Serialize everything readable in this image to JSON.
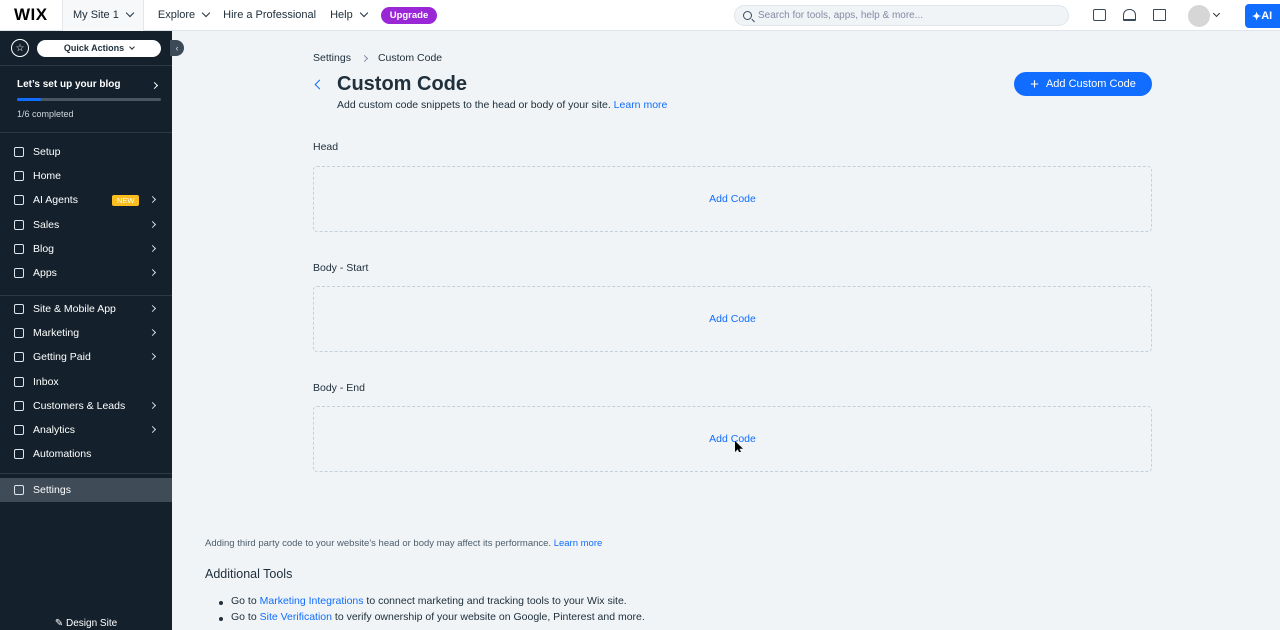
{
  "topbar": {
    "logo": "WIX",
    "site_name": "My Site 1",
    "nav": [
      "Explore",
      "Hire a Professional",
      "Help"
    ],
    "upgrade_label": "Upgrade",
    "search_placeholder": "Search for tools, apps, help & more...",
    "ai_label": "AI"
  },
  "sidebar": {
    "quick_actions": "Quick Actions",
    "setup_title": "Let’s set up your blog",
    "progress_fraction": 0.167,
    "completed_text": "1/6 completed",
    "items_group1": [
      {
        "label": "Setup"
      },
      {
        "label": "Home"
      },
      {
        "label": "AI Agents",
        "badge": "NEW"
      },
      {
        "label": "Sales"
      },
      {
        "label": "Blog"
      },
      {
        "label": "Apps"
      }
    ],
    "items_group2": [
      {
        "label": "Site & Mobile App"
      },
      {
        "label": "Marketing"
      },
      {
        "label": "Getting Paid"
      },
      {
        "label": "Inbox"
      },
      {
        "label": "Customers & Leads"
      },
      {
        "label": "Analytics"
      },
      {
        "label": "Automations"
      }
    ],
    "settings_label": "Settings",
    "design_site": "Design Site"
  },
  "main": {
    "breadcrumb": {
      "parent": "Settings",
      "current": "Custom Code"
    },
    "title": "Custom Code",
    "subtitle": "Add custom code snippets to the head or body of your site.",
    "learn_more": "Learn more",
    "add_custom_code": "Add Custom Code",
    "sections": [
      {
        "label": "Head",
        "action": "Add Code"
      },
      {
        "label": "Body - Start",
        "action": "Add Code"
      },
      {
        "label": "Body - End",
        "action": "Add Code"
      }
    ],
    "footer_note": "Adding third party code to your website’s head or body may affect its performance.",
    "footer_learn_more": "Learn more",
    "additional_tools_title": "Additional Tools",
    "tools": [
      {
        "prefix": "Go to",
        "link": "Marketing Integrations",
        "suffix": "to connect marketing and tracking tools to your Wix site."
      },
      {
        "prefix": "Go to",
        "link": "Site Verification",
        "suffix": "to verify ownership of your website on Google, Pinterest and more."
      }
    ]
  }
}
